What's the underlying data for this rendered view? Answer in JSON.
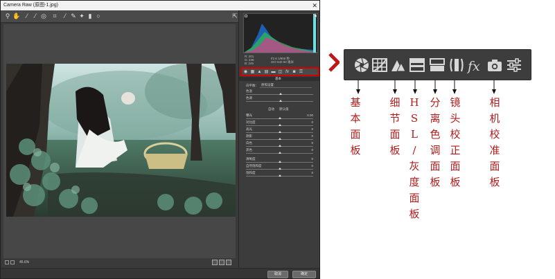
{
  "window": {
    "title": "Camera Raw (原图-1.jpg)",
    "close_glyph": "✕",
    "zoom_label": "45.6%",
    "cancel_label": "取消",
    "ok_label": "确定"
  },
  "panel": {
    "info_lines": [
      "R:  201",
      "G:  236",
      "B:  245"
    ],
    "meta_lines": [
      "f/2.8   1/800 秒",
      "ISO 640   50 毫米"
    ],
    "section_title": "基本",
    "wb_label": "白平衡：",
    "wb_value": "原照设置",
    "auto_label": "自动",
    "default_label": "默认值",
    "sliders": [
      {
        "label": "色温",
        "value": "",
        "pos": 0.52
      },
      {
        "label": "色调",
        "value": "",
        "pos": 0.52
      },
      {
        "label": "曝光",
        "value": "0.00",
        "pos": 0.5
      },
      {
        "label": "对比度",
        "value": "0",
        "pos": 0.5
      },
      {
        "label": "高光",
        "value": "0",
        "pos": 0.5
      },
      {
        "label": "阴影",
        "value": "0",
        "pos": 0.5
      },
      {
        "label": "白色",
        "value": "0",
        "pos": 0.5
      },
      {
        "label": "黑色",
        "value": "0",
        "pos": 0.5
      },
      {
        "label": "清晰度",
        "value": "0",
        "pos": 0.5
      },
      {
        "label": "自然饱和度",
        "value": "0",
        "pos": 0.5
      },
      {
        "label": "饱和度",
        "value": "0",
        "pos": 0.5
      }
    ]
  },
  "annotation": {
    "accent_color": "#b01c1c",
    "labels": [
      {
        "name": "label-basic-panel",
        "text": "基本面板"
      },
      {
        "name": "label-detail-panel",
        "text": "细节面板"
      },
      {
        "name": "label-hsl-panel",
        "text": "HSL/灰度面板"
      },
      {
        "name": "label-split-toning-panel",
        "text": "分离色调面板"
      },
      {
        "name": "label-lens-corrections-panel",
        "text": "镜头校正面板"
      },
      {
        "name": "label-camera-calibration-panel",
        "text": "相机校准面板"
      }
    ]
  }
}
